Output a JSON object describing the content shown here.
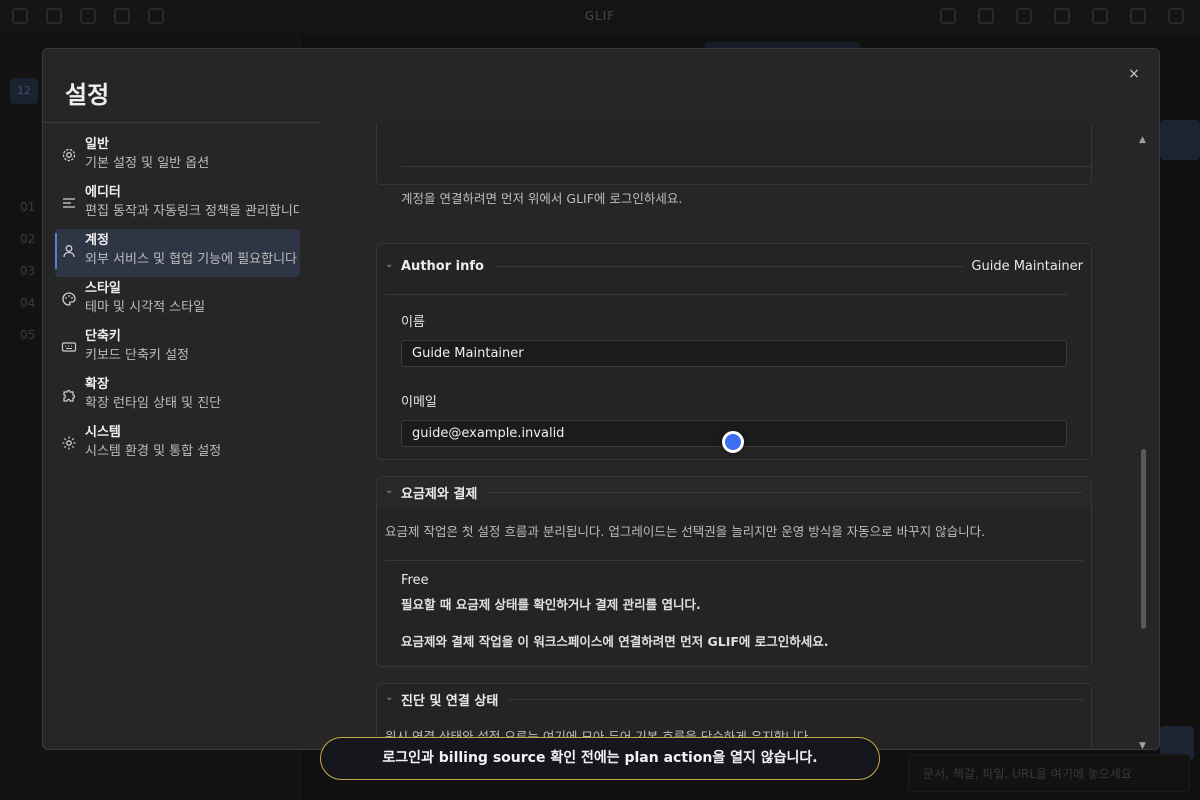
{
  "app": {
    "title": "GLIF",
    "left_rows": [
      "01",
      "02",
      "03",
      "04",
      "05"
    ],
    "left_tag": "12",
    "input_placeholder": "문서, 책갈, 파일, URL을 여기에 놓으세요"
  },
  "dialog": {
    "title": "설정",
    "close_label": "×"
  },
  "nav": [
    {
      "title": "일반",
      "desc": "기본 설정 및 일반 옵션",
      "icon": "gear-icon",
      "active": false
    },
    {
      "title": "에디터",
      "desc": "편집 동작과 자동링크 정책을 관리합니다",
      "icon": "lines-icon",
      "active": false
    },
    {
      "title": "계정",
      "desc": "외부 서비스 및 협업 기능에 필요합니다",
      "icon": "user-icon",
      "active": true
    },
    {
      "title": "스타일",
      "desc": "테마 및 시각적 스타일",
      "icon": "palette-icon",
      "active": false
    },
    {
      "title": "단축키",
      "desc": "키보드 단축키 설정",
      "icon": "keyboard-icon",
      "active": false
    },
    {
      "title": "확장",
      "desc": "확장 런타임 상태 및 진단",
      "icon": "puzzle-icon",
      "active": false
    },
    {
      "title": "시스템",
      "desc": "시스템 환경 및 통합 설정",
      "icon": "settings-icon",
      "active": false
    }
  ],
  "account": {
    "login_hint": "계정을 연결하려면 먼저 위에서 GLIF에 로그인하세요.",
    "author": {
      "title": "Author info",
      "summary": "Guide Maintainer",
      "name_label": "이름",
      "name_value": "Guide Maintainer",
      "email_label": "이메일",
      "email_value": "guide@example.invalid"
    },
    "billing": {
      "title": "요금제와 결제",
      "desc": "요금제 작업은 첫 설정 흐름과 분리됩니다. 업그레이드는 선택권을 늘리지만 운영 방식을 자동으로 바꾸지 않습니다.",
      "plan": "Free",
      "plan_desc": "필요할 때 요금제 상태를 확인하거나 결제 관리를 엽니다.",
      "login_note": "요금제와 결제 작업을 이 워크스페이스에 연결하려면 먼저 GLIF에 로그인하세요."
    },
    "diagnostics": {
      "title": "진단 및 연결 상태",
      "desc": "원시 연결 상태와 설정 오류는 여기에 모아 두어 기본 흐름을 단순하게 유지합니다."
    }
  },
  "toast": "로그인과 billing source 확인 전에는 plan action을 열지 않습니다.",
  "colors": {
    "accent": "#5a7fd1",
    "cursor": "#3d6df0",
    "toast_border": "#c9a84a"
  }
}
